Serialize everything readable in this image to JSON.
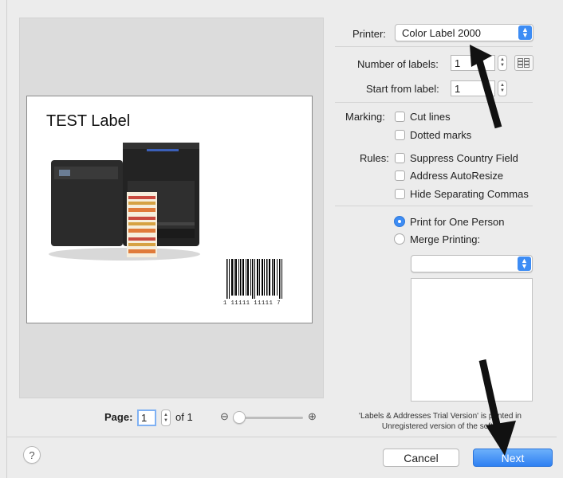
{
  "preview": {
    "label_title": "TEST Label",
    "barcode_digits": "1 11111 11111 7"
  },
  "printer": {
    "label": "Printer:",
    "value": "Color Label 2000"
  },
  "number_of_labels": {
    "label": "Number of labels:",
    "value": "1"
  },
  "start_from_label": {
    "label": "Start from label:",
    "value": "1"
  },
  "marking": {
    "label": "Marking:",
    "options": [
      {
        "label": "Cut lines",
        "checked": false
      },
      {
        "label": "Dotted marks",
        "checked": false
      }
    ]
  },
  "rules": {
    "label": "Rules:",
    "options": [
      {
        "label": "Suppress Country Field",
        "checked": false
      },
      {
        "label": "Address AutoResize",
        "checked": false
      },
      {
        "label": "Hide Separating Commas",
        "checked": false
      }
    ]
  },
  "print_mode": {
    "options": [
      {
        "label": "Print for One Person",
        "selected": true
      },
      {
        "label": "Merge Printing:",
        "selected": false
      }
    ],
    "merge_source": ""
  },
  "pager": {
    "label": "Page:",
    "value": "1",
    "of_label": "of 1"
  },
  "zoom": {
    "level": 0
  },
  "note": {
    "line1": "'Labels & Addresses Trial Version' is printed in",
    "line2": "Unregistered version of the softw"
  },
  "buttons": {
    "cancel": "Cancel",
    "next": "Next",
    "help": "?"
  },
  "colors": {
    "accent": "#3d8cf4",
    "annotation_arrow": "#111111"
  }
}
